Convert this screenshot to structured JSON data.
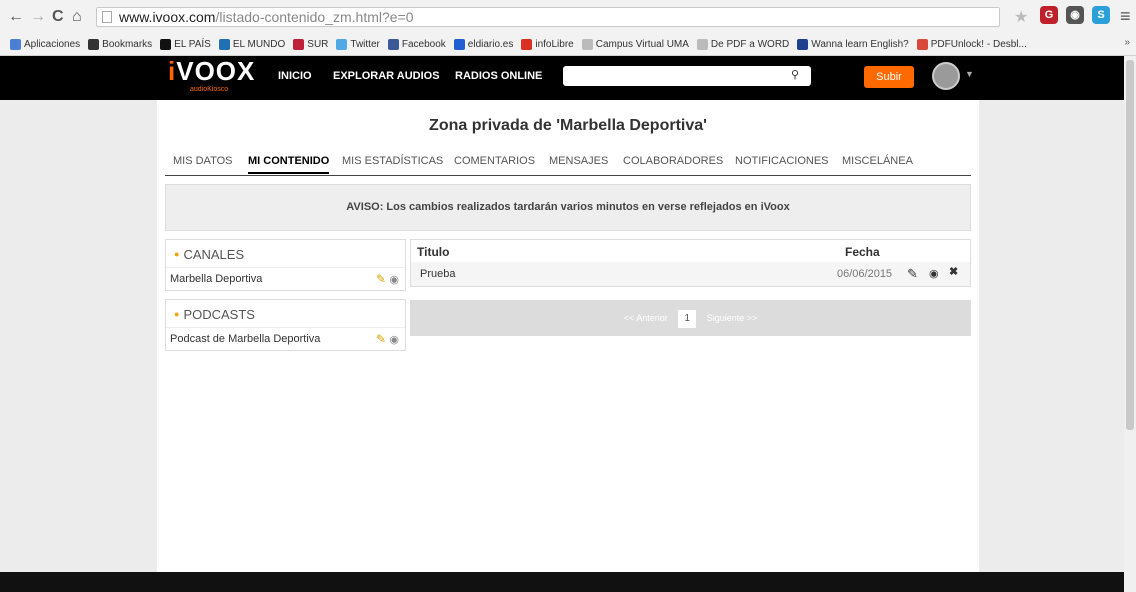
{
  "browser": {
    "back": "←",
    "forward": "→",
    "reload": "C",
    "home": "⌂",
    "url_domain": "www.ivoox.com",
    "url_path": "/listado-contenido_zm.html?e=0",
    "star": "★",
    "menu": "≡"
  },
  "bookmarks": [
    {
      "label": "Aplicaciones",
      "icon": "apps-icon",
      "color": "#4a7fd4"
    },
    {
      "label": "Bookmarks",
      "icon": "star-icon",
      "color": "#333333"
    },
    {
      "label": "EL PAÍS",
      "icon": "elpais-icon",
      "color": "#111111"
    },
    {
      "label": "EL MUNDO",
      "icon": "elmundo-icon",
      "color": "#1f6fb2"
    },
    {
      "label": "SUR",
      "icon": "sur-icon",
      "color": "#c0203a"
    },
    {
      "label": "Twitter",
      "icon": "twitter-icon",
      "color": "#4fa9e6"
    },
    {
      "label": "Facebook",
      "icon": "facebook-icon",
      "color": "#3b5998"
    },
    {
      "label": "eldiario.es",
      "icon": "eldiario-icon",
      "color": "#1f5fd1"
    },
    {
      "label": "infoLibre",
      "icon": "infolibre-icon",
      "color": "#d93021"
    },
    {
      "label": "Campus Virtual UMA",
      "icon": "page-icon",
      "color": "#bbbbbb"
    },
    {
      "label": "De PDF a WORD",
      "icon": "page-icon",
      "color": "#bbbbbb"
    },
    {
      "label": "Wanna learn English?",
      "icon": "uk-flag-icon",
      "color": "#1f3f8f"
    },
    {
      "label": "PDFUnlock! - Desbl...",
      "icon": "pdf-icon",
      "color": "#d84a3a"
    }
  ],
  "bookmarks_more": "»",
  "site": {
    "logo_main": "VOOX",
    "logo_i": "i",
    "logo_sub": "audioKiosco",
    "nav": [
      "INICIO",
      "EXPLORAR AUDIOS",
      "RADIOS ONLINE"
    ],
    "search_placeholder": "",
    "upload": "Subir"
  },
  "page": {
    "title": "Zona privada de 'Marbella Deportiva'",
    "tabs": [
      "MIS DATOS",
      "MI CONTENIDO",
      "MIS ESTADÍSTICAS",
      "COMENTARIOS",
      "MENSAJES",
      "COLABORADORES",
      "NOTIFICACIONES",
      "MISCELÁNEA"
    ],
    "notice": "AVISO: Los cambios realizados tardarán varios minutos en verse reflejados en iVoox",
    "channels": {
      "heading": "CANALES",
      "items": [
        "Marbella Deportiva"
      ]
    },
    "podcasts": {
      "heading": "PODCASTS",
      "items": [
        "Podcast de Marbella Deportiva"
      ]
    },
    "table": {
      "headers": [
        "Titulo",
        "Fecha"
      ],
      "rows": [
        {
          "title": "Prueba",
          "date": "06/06/2015"
        }
      ]
    },
    "pager": {
      "prev": "<< Anterior",
      "page": "1",
      "next": "Siguiente >>"
    }
  },
  "colors": {
    "accent": "#ff6a00",
    "header_bg": "#000000",
    "pencil": "#d8a200",
    "delete": "#d42222"
  }
}
